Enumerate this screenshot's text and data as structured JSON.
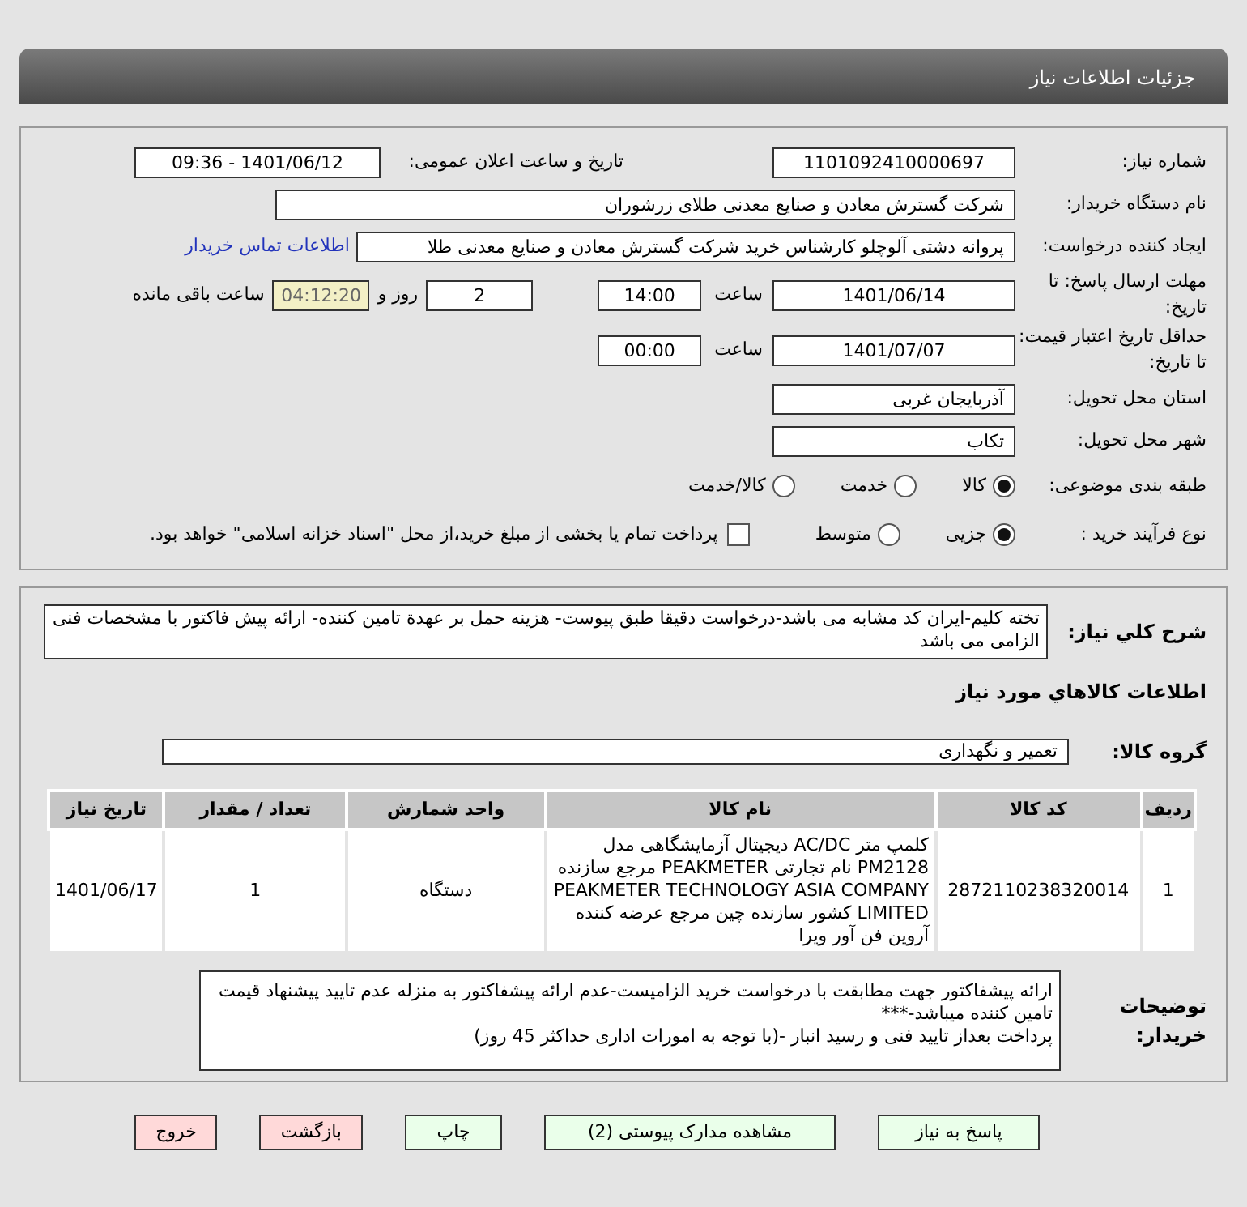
{
  "header": {
    "title": "جزئیات اطلاعات نیاز"
  },
  "need_number": {
    "label": "شماره نیاز:",
    "value": "1101092410000697"
  },
  "announce": {
    "label": "تاریخ و ساعت اعلان عمومی:",
    "value": "1401/06/12 - 09:36"
  },
  "buyer": {
    "label": "نام دستگاه خریدار:",
    "value": "شرکت گسترش معادن و صنایع معدنی طلای زرشوران"
  },
  "creator": {
    "label": "ایجاد کننده درخواست:",
    "value": "پروانه  دشتی آلوچلو کارشناس خرید شرکت گسترش معادن و صنایع معدنی طلا",
    "link": "اطلاعات تماس خریدار"
  },
  "deadline": {
    "label": "مهلت ارسال پاسخ: تا تاریخ:",
    "date": "1401/06/14",
    "time_label": "ساعت",
    "time": "14:00",
    "days": "2",
    "days_label": "روز و",
    "remaining": "04:12:20",
    "remaining_label": "ساعت باقی مانده"
  },
  "validity": {
    "label": "حداقل تاریخ اعتبار قیمت: تا تاریخ:",
    "date": "1401/07/07",
    "time_label": "ساعت",
    "time": "00:00"
  },
  "province": {
    "label": "استان محل تحویل:",
    "value": "آذربایجان غربی"
  },
  "city": {
    "label": "شهر محل تحویل:",
    "value": "تکاب"
  },
  "category": {
    "label": "طبقه بندی موضوعی:",
    "options": [
      {
        "label": "کالا",
        "selected": true
      },
      {
        "label": "خدمت",
        "selected": false
      },
      {
        "label": "کالا/خدمت",
        "selected": false
      }
    ]
  },
  "process": {
    "label": "نوع فرآیند خرید :",
    "options": [
      {
        "label": "جزیی",
        "selected": true
      },
      {
        "label": "متوسط",
        "selected": false
      }
    ],
    "treasury": {
      "label": "پرداخت تمام یا بخشی از مبلغ خرید،از محل \"اسناد خزانه اسلامی\" خواهد بود.",
      "checked": false
    }
  },
  "description": {
    "label": "شرح کلي نياز:",
    "value": "تخته کلیم-ایران کد مشابه می باشد-درخواست دقیقا طبق پیوست- هزینه حمل بر عهدة تامین کننده- ارائه پیش فاکتور با مشخصات فنی الزامی می باشد"
  },
  "goods_heading": "اطلاعات كالاهاي مورد نياز",
  "goods_group": {
    "label": "گروه کالا:",
    "value": "تعمیر و نگهداری"
  },
  "table": {
    "columns": [
      "ردیف",
      "کد کالا",
      "نام کالا",
      "واحد شمارش",
      "تعداد / مقدار",
      "تاریخ نیاز"
    ],
    "rows": [
      [
        "1",
        "2872110238320014",
        "کلمپ متر AC/DC دیجیتال آزمایشگاهی مدل PM2128 نام تجارتی PEAKMETER مرجع سازنده PEAKMETER TECHNOLOGY ASIA COMPANY LIMITED کشور سازنده چین مرجع عرضه کننده آروین فن آور ویرا",
        "دستگاه",
        "1",
        "1401/06/17"
      ]
    ]
  },
  "buyer_notes": {
    "label": "توضیحات خریدار:",
    "lines": [
      "ارائه پیشفاکتور جهت مطابقت با درخواست خرید الزامیست-عدم ارائه پیشفاکتور به منزله عدم تایید پیشنهاد قیمت تامین کننده میباشد-***",
      "پرداخت بعداز تایید فنی و رسید انبار -(با توجه به امورات اداری حداکثر 45 روز)"
    ]
  },
  "buttons": [
    {
      "label": "پاسخ به نیاز",
      "kind": "green"
    },
    {
      "label": "مشاهده مدارک پیوستی (2)",
      "kind": "green"
    },
    {
      "label": "چاپ",
      "kind": "green"
    },
    {
      "label": "بازگشت",
      "kind": "red"
    },
    {
      "label": "خروج",
      "kind": "red"
    }
  ]
}
